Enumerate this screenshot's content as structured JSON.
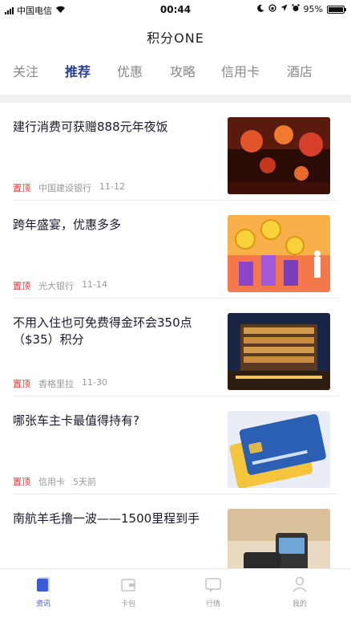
{
  "status_bar": {
    "carrier": "中国电信",
    "time": "00:44",
    "battery": "95%"
  },
  "app_title": "积分ONE",
  "tabs": [
    {
      "label": "关注"
    },
    {
      "label": "推荐"
    },
    {
      "label": "优惠"
    },
    {
      "label": "攻略"
    },
    {
      "label": "信用卡"
    },
    {
      "label": "酒店"
    }
  ],
  "active_tab": "推荐",
  "feed": [
    {
      "title": "建行消费可获赠888元年夜饭",
      "pin": "置顶",
      "source": "中国建设银行",
      "date": "11-12",
      "thumb": "red-lanterns"
    },
    {
      "title": "跨年盛宴，优惠多多",
      "pin": "置顶",
      "source": "光大银行",
      "date": "11-14",
      "thumb": "coins-illustration"
    },
    {
      "title": "不用入住也可免费得金环会350点（$35）积分",
      "pin": "置顶",
      "source": "香格里拉",
      "date": "11-30",
      "thumb": "hotel-night"
    },
    {
      "title": "哪张车主卡最值得持有?",
      "pin": "置顶",
      "source": "信用卡",
      "date": "5天前",
      "thumb": "credit-cards"
    },
    {
      "title": "南航羊毛撸一波——1500里程到手",
      "pin": "",
      "source": "",
      "date": "",
      "thumb": "payment-terminal"
    }
  ],
  "bottom_nav": [
    {
      "label": "资讯",
      "icon": "news-icon"
    },
    {
      "label": "卡包",
      "icon": "wallet-icon"
    },
    {
      "label": "行情",
      "icon": "chat-icon"
    },
    {
      "label": "我的",
      "icon": "user-icon"
    }
  ],
  "colors": {
    "accent": "#3b5bdb",
    "pin": "#e0413c"
  }
}
